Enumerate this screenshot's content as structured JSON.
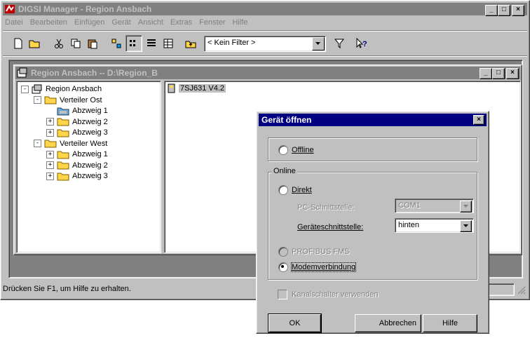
{
  "main_window": {
    "title": "DIGSI Manager - Region Ansbach",
    "menu": [
      "Datei",
      "Bearbeiten",
      "Einfügen",
      "Gerät",
      "Ansicht",
      "Extras",
      "Fenster",
      "Hilfe"
    ],
    "menu_hotkeys": [
      "D",
      "B",
      "E",
      "G",
      "A",
      "x",
      "F",
      "H"
    ],
    "filter_value": "< Kein Filter >",
    "status_text": "Drücken Sie F1, um Hilfe zu erhalten."
  },
  "project_window": {
    "title": "Region Ansbach -- D:\\Region_B",
    "tree": [
      {
        "label": "Region Ansbach",
        "level": 0,
        "expander": "-",
        "icon": "project-icon"
      },
      {
        "label": "Verteiler Ost",
        "level": 1,
        "expander": "-",
        "icon": "folder-icon"
      },
      {
        "label": "Abzweig 1",
        "level": 2,
        "expander": "",
        "icon": "folder-open-icon"
      },
      {
        "label": "Abzweig 2",
        "level": 2,
        "expander": "+",
        "icon": "folder-icon"
      },
      {
        "label": "Abzweig 3",
        "level": 2,
        "expander": "+",
        "icon": "folder-icon"
      },
      {
        "label": "Verteiler West",
        "level": 1,
        "expander": "-",
        "icon": "folder-icon"
      },
      {
        "label": "Abzweig 1",
        "level": 2,
        "expander": "+",
        "icon": "folder-icon"
      },
      {
        "label": "Abzweig 2",
        "level": 2,
        "expander": "+",
        "icon": "folder-icon"
      },
      {
        "label": "Abzweig 3",
        "level": 2,
        "expander": "+",
        "icon": "folder-icon"
      }
    ],
    "list_item": "7SJ631 V4.2"
  },
  "dialog": {
    "title": "Gerät öffnen",
    "offline_label": "Offline",
    "online_group_label": "Online",
    "direkt_label": "Direkt",
    "pc_interface_label": "PC-Schnittstelle:",
    "pc_interface_value": "COM1",
    "device_interface_label": "Geräteschnittstelle:",
    "device_interface_value": "hinten",
    "profibus_label": "PROFIBUS FMS",
    "modem_label": "Modemverbindung",
    "channel_switch_label": "Kanalschalter verwenden",
    "ok_label": "OK",
    "cancel_label": "Abbrechen",
    "help_label": "Hilfe",
    "selected_option": "Modemverbindung"
  },
  "colors": {
    "active_title": "#000080",
    "inactive_title": "#808080",
    "face": "#c0c0c0",
    "folder": "#ffd54a"
  }
}
